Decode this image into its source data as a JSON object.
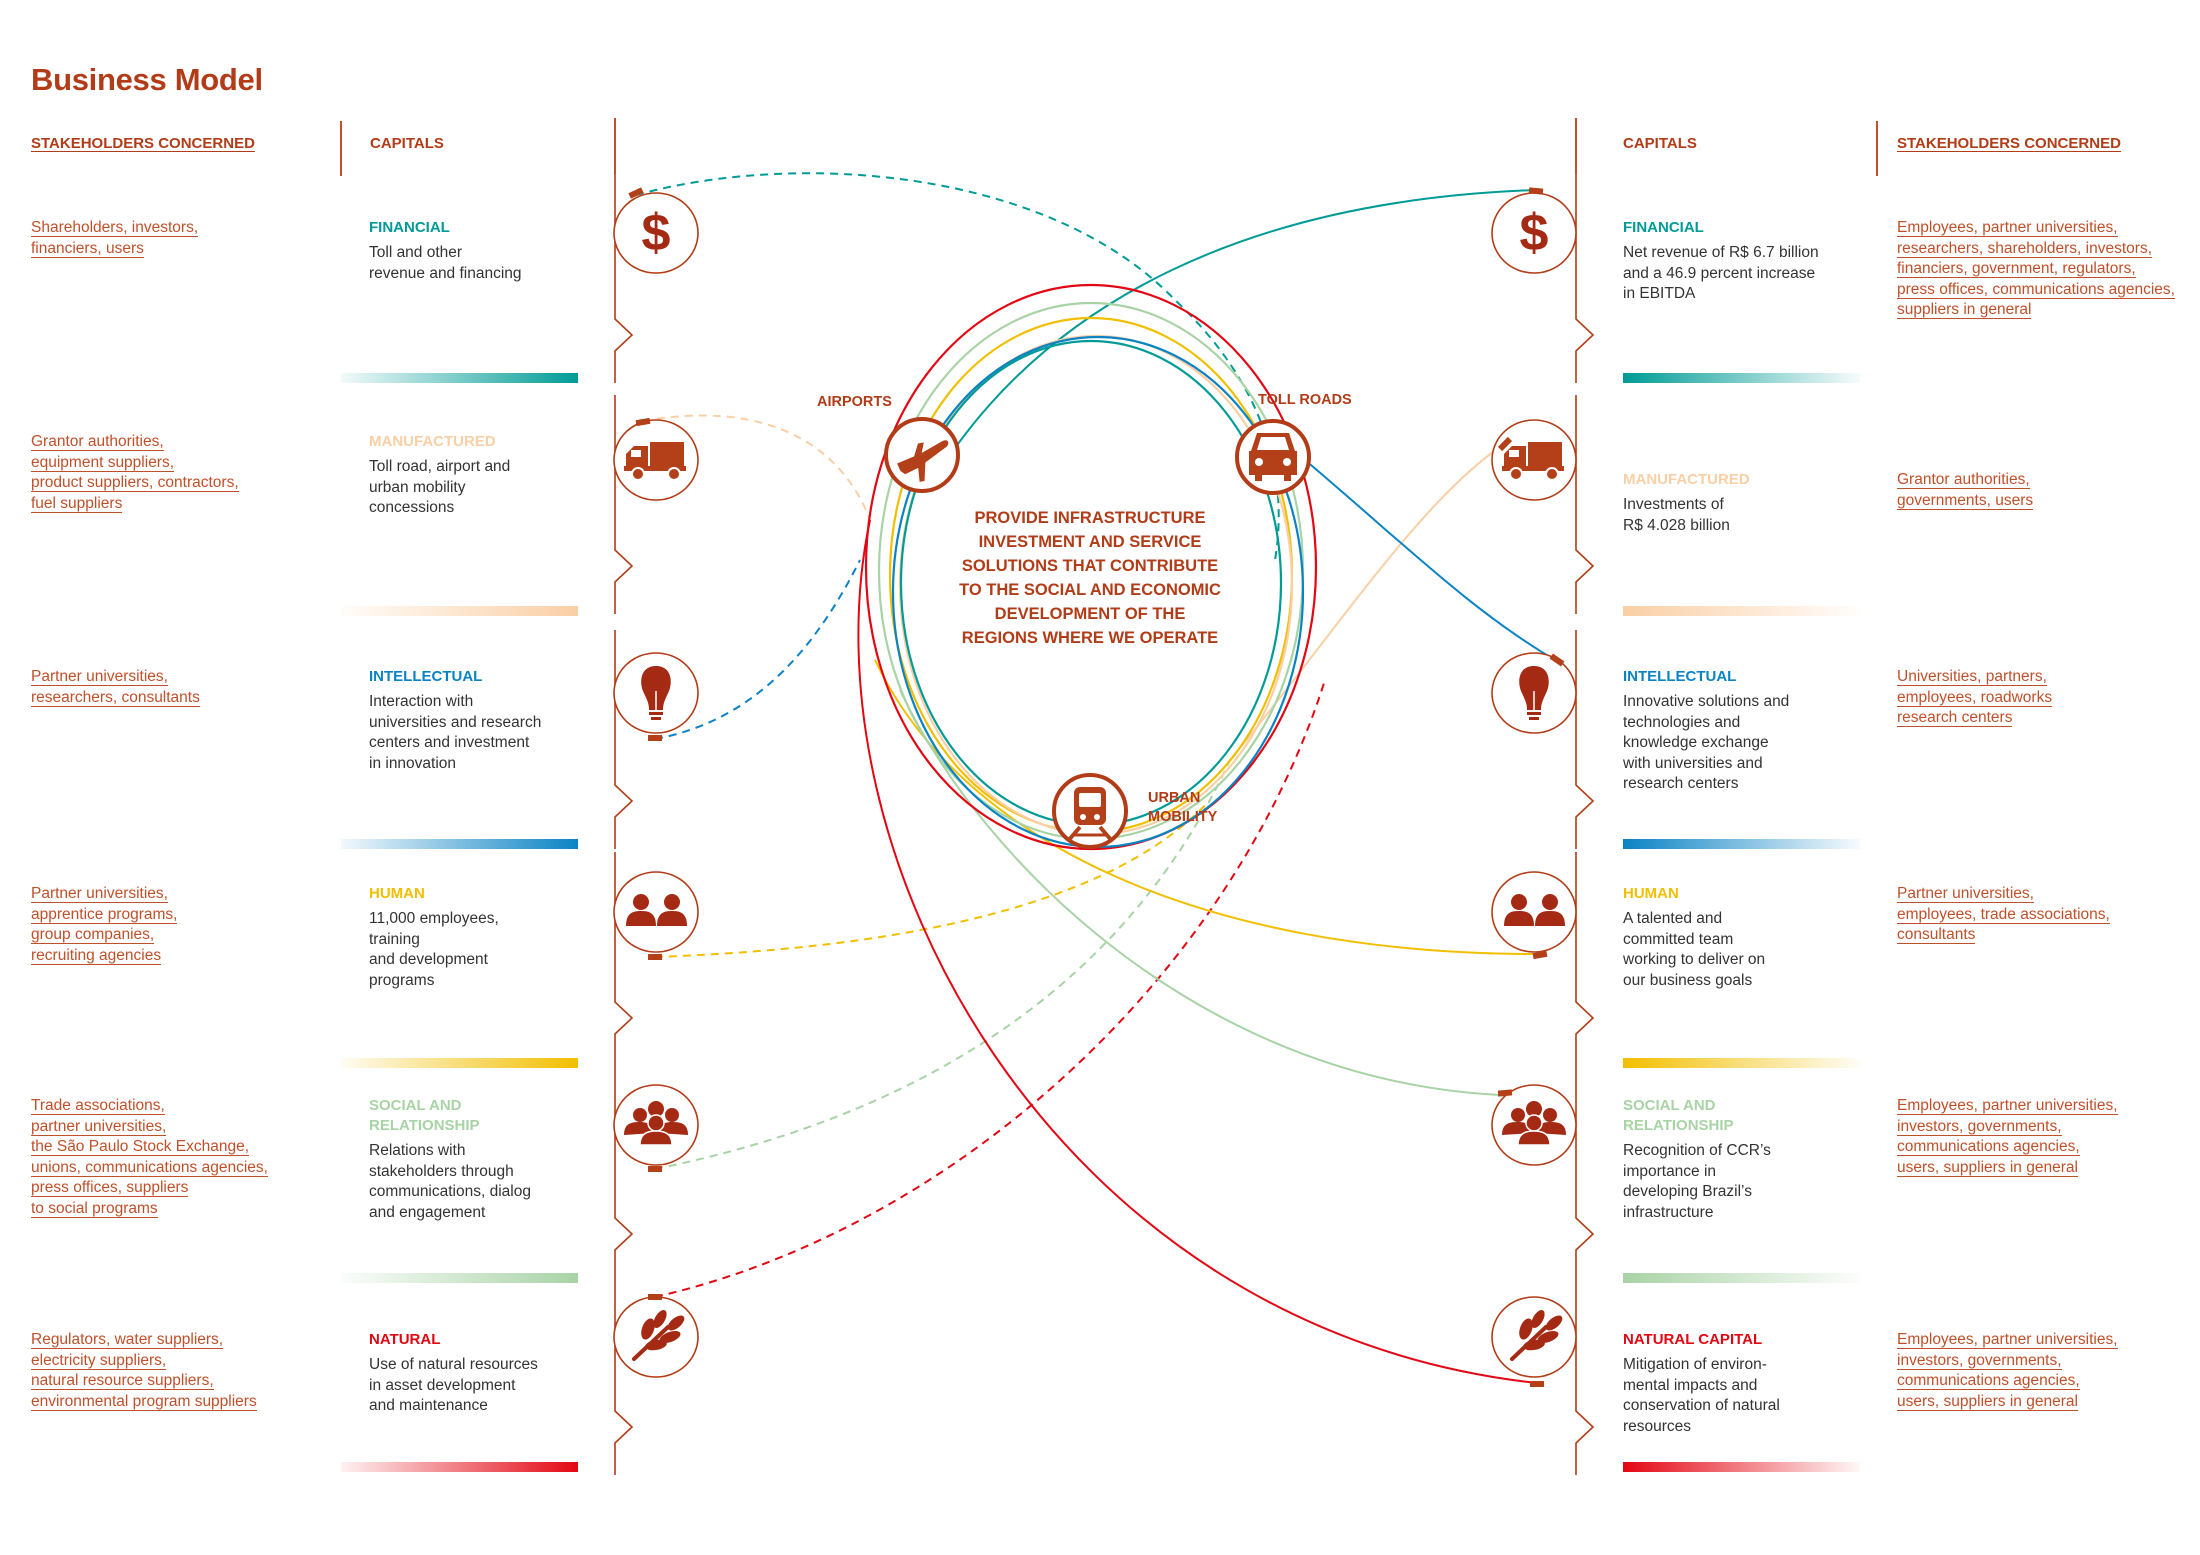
{
  "title": "Business Model",
  "headers": {
    "left_stakeholders": "STAKEHOLDERS CONCERNED",
    "left_capitals": "CAPITALS",
    "right_capitals": "CAPITALS",
    "right_stakeholders": "STAKEHOLDERS CONCERNED"
  },
  "colors": {
    "brand": "#b23c17",
    "financial": "#009b96",
    "manufactured": "#f9cfa5",
    "intellectual": "#0a83c4",
    "human": "#f2bf00",
    "social": "#a8d3a5",
    "natural": "#e30613"
  },
  "center": {
    "mission": [
      "PROVIDE INFRASTRUCTURE",
      "INVESTMENT AND SERVICE",
      "SOLUTIONS THAT CONTRIBUTE",
      "TO THE SOCIAL AND ECONOMIC",
      "DEVELOPMENT OF THE",
      "REGIONS WHERE WE OPERATE"
    ],
    "hubs": [
      {
        "label": "AIRPORTS",
        "icon": "airplane-icon"
      },
      {
        "label": "TOLL ROADS",
        "icon": "car-icon"
      },
      {
        "label_lines": [
          "URBAN",
          "MOBILITY"
        ],
        "icon": "train-icon"
      }
    ]
  },
  "inputs": [
    {
      "key": "financial",
      "name": "FINANCIAL",
      "icon": "dollar-icon",
      "desc": [
        "Toll and other",
        "revenue and financing"
      ],
      "stakeholders": [
        "Shareholders, investors,",
        "financiers, users"
      ]
    },
    {
      "key": "manufactured",
      "name": "MANUFACTURED",
      "icon": "truck-icon",
      "desc": [
        "Toll road, airport and",
        "urban mobility",
        "concessions"
      ],
      "stakeholders": [
        "Grantor authorities,",
        "equipment suppliers,",
        "product suppliers, contractors,",
        "fuel suppliers"
      ]
    },
    {
      "key": "intellectual",
      "name": "INTELLECTUAL",
      "icon": "lightbulb-icon",
      "desc": [
        "Interaction with",
        "universities and research",
        "centers and investment",
        "in innovation"
      ],
      "stakeholders": [
        "Partner universities,",
        "researchers, consultants"
      ]
    },
    {
      "key": "human",
      "name": "HUMAN",
      "icon": "people-pair-icon",
      "desc": [
        "11,000 employees,",
        "training",
        "and development",
        "programs"
      ],
      "stakeholders": [
        "Partner universities,",
        "apprentice programs,",
        "group companies,",
        "recruiting agencies"
      ]
    },
    {
      "key": "social",
      "name_lines": [
        "SOCIAL AND",
        "RELATIONSHIP"
      ],
      "icon": "group-icon",
      "desc": [
        "Relations with",
        "stakeholders through",
        "communications, dialog",
        "and engagement"
      ],
      "stakeholders": [
        "Trade associations,",
        "partner universities,",
        "the São Paulo Stock Exchange,",
        "unions, communications agencies,",
        "press offices, suppliers",
        "to social programs"
      ]
    },
    {
      "key": "natural",
      "name": "NATURAL",
      "icon": "leaf-icon",
      "desc": [
        "Use of natural resources",
        "in asset development",
        "and maintenance"
      ],
      "stakeholders": [
        "Regulators, water suppliers,",
        "electricity suppliers,",
        "natural resource suppliers,",
        "environmental program suppliers"
      ]
    }
  ],
  "outputs": [
    {
      "key": "financial",
      "name": "FINANCIAL",
      "icon": "dollar-icon",
      "desc": [
        "Net revenue of R$ 6.7 billion",
        "and a 46.9 percent increase",
        "in EBITDA"
      ],
      "stakeholders": [
        "Employees, partner universities,",
        "researchers, shareholders, investors,",
        "financiers, government, regulators,",
        "press offices, communications agencies,",
        "suppliers in general"
      ]
    },
    {
      "key": "manufactured",
      "name": "MANUFACTURED",
      "icon": "truck-icon",
      "desc": [
        "Investments of",
        "R$ 4.028 billion"
      ],
      "stakeholders": [
        "Grantor authorities,",
        "governments, users"
      ]
    },
    {
      "key": "intellectual",
      "name": "INTELLECTUAL",
      "icon": "lightbulb-icon",
      "desc": [
        "Innovative solutions and",
        "technologies and",
        "knowledge exchange",
        "with universities and",
        "research centers"
      ],
      "stakeholders": [
        "Universities, partners,",
        "employees, roadworks",
        "research centers"
      ]
    },
    {
      "key": "human",
      "name": "HUMAN",
      "icon": "people-pair-icon",
      "desc": [
        "A talented and",
        "committed team",
        "working to deliver on",
        "our business goals"
      ],
      "stakeholders": [
        "Partner universities,",
        "employees, trade associations,",
        "consultants"
      ]
    },
    {
      "key": "social",
      "name_lines": [
        "SOCIAL AND",
        "RELATIONSHIP"
      ],
      "icon": "group-icon",
      "desc": [
        "Recognition of CCR’s",
        "importance in",
        "developing Brazil’s",
        "infrastructure"
      ],
      "stakeholders": [
        "Employees, partner universities,",
        "investors, governments,",
        "communications agencies,",
        "users, suppliers in general"
      ]
    },
    {
      "key": "natural",
      "name": "NATURAL CAPITAL",
      "icon": "leaf-icon",
      "desc": [
        "Mitigation of environ-",
        "mental impacts and",
        "conservation of natural",
        "resources"
      ],
      "stakeholders": [
        "Employees, partner universities,",
        "investors, governments,",
        "communications agencies,",
        "users, suppliers in general"
      ]
    }
  ]
}
